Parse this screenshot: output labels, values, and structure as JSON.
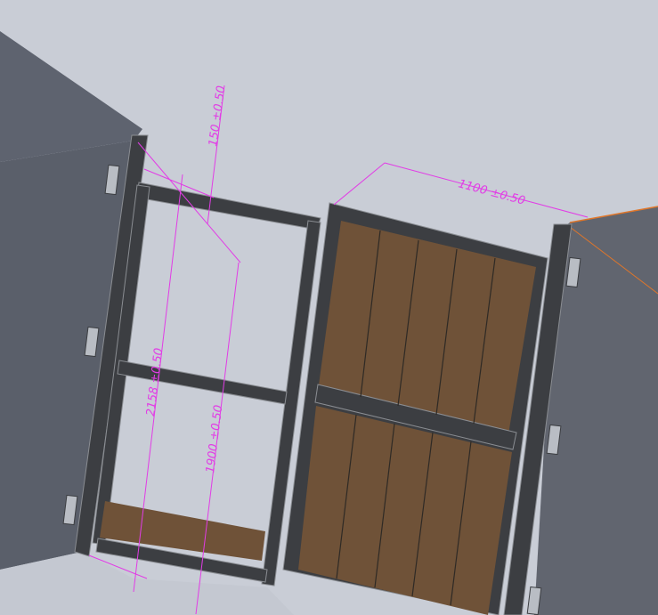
{
  "colors": {
    "background": "#c9cdd6",
    "wall_left": "#5e636f",
    "wall_left_dark": "#4f535e",
    "wall_right": "#61656f",
    "frame_steel": "#3c3e42",
    "frame_edge": "#8a8d92",
    "wood_panel": "#6f5238",
    "wood_line": "#2f2a25",
    "dimension": "#e23ce6",
    "edge_highlight": "#e0762a"
  },
  "dimensions": {
    "top_rail_offset": "150 ±0.50",
    "overall_height": "2158 ±0.50",
    "inner_height": "1900 ±0.50",
    "leaf_width": "1100 ±0.50"
  }
}
